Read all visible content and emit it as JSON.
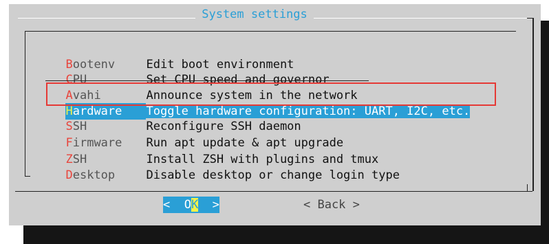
{
  "dialog": {
    "title": "System settings"
  },
  "menu": {
    "items": [
      {
        "tag_first": "B",
        "tag_rest": "ootenv",
        "description": "Edit boot environment"
      },
      {
        "tag_first": "C",
        "tag_rest": "PU",
        "description": "Set CPU speed and governor"
      },
      {
        "tag_first": "A",
        "tag_rest": "vahi",
        "description": "Announce system in the network"
      },
      {
        "tag_first": "H",
        "tag_rest": "ardware",
        "description": "Toggle hardware configuration: UART, I2C, etc.",
        "selected": true
      },
      {
        "tag_first": "S",
        "tag_rest": "SH",
        "description": "Reconfigure SSH daemon"
      },
      {
        "tag_first": "F",
        "tag_rest": "irmware",
        "description": "Run apt update & apt upgrade"
      },
      {
        "tag_first": "Z",
        "tag_rest": "SH",
        "description": "Install ZSH with plugins and tmux"
      },
      {
        "tag_first": "D",
        "tag_rest": "esktop",
        "description": "Disable desktop or change login type"
      }
    ]
  },
  "buttons": {
    "ok_left": "<  O",
    "ok_hot": "K",
    "ok_right": "  >",
    "back": "< Back >"
  },
  "colors": {
    "dialog_bg": "#cfcfcf",
    "accent": "#2a9fd6",
    "hotkey": "#e8453c",
    "selected_hotkey": "#f2f24a",
    "annotation": "#e53935",
    "shadow": "#151515"
  }
}
